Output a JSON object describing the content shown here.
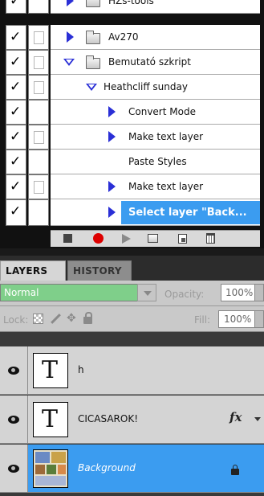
{
  "actions": {
    "rows": [
      {
        "label": "HZs-tools",
        "type": "set",
        "expanded": false,
        "checked": true,
        "dialog": true
      },
      {
        "label": "Av270",
        "type": "set",
        "expanded": false,
        "checked": true,
        "dialog": true
      },
      {
        "label": "Bemutató szkript",
        "type": "set",
        "expanded": true,
        "checked": true,
        "dialog": true
      },
      {
        "label": "Heathcliff sunday",
        "type": "action",
        "expanded": true,
        "checked": true,
        "dialog": true
      },
      {
        "label": "Convert Mode",
        "type": "step",
        "expanded": false,
        "checked": true,
        "dialog": false
      },
      {
        "label": "Make text layer",
        "type": "step",
        "expanded": false,
        "checked": true,
        "dialog": true
      },
      {
        "label": "Paste Styles",
        "type": "step",
        "expanded": false,
        "checked": true,
        "dialog": false
      },
      {
        "label": "Make text layer",
        "type": "step",
        "expanded": false,
        "checked": true,
        "dialog": true
      },
      {
        "label": "Select layer \"Back...",
        "type": "step",
        "expanded": false,
        "checked": true,
        "dialog": false,
        "selected": true
      }
    ],
    "check_glyph": "✓"
  },
  "layers_panel": {
    "tabs": [
      "LAYERS",
      "HISTORY"
    ],
    "blend_mode": "Normal",
    "opacity_label": "Opacity:",
    "opacity_value": "100%",
    "lock_label": "Lock:",
    "fill_label": "Fill:",
    "fill_value": "100%",
    "layers": [
      {
        "name": "h",
        "thumb": "T",
        "fx": false
      },
      {
        "name": "CICASAROK!",
        "thumb": "T",
        "fx": true,
        "fx_label": "fx"
      },
      {
        "name": "Background",
        "thumb": "image",
        "locked": true,
        "selected": true
      }
    ]
  },
  "colors": {
    "selection": "#3b9cf0",
    "blend_green": "#7fcf8a",
    "triangle_blue": "#2a2fd6",
    "record_red": "#dd0000"
  }
}
